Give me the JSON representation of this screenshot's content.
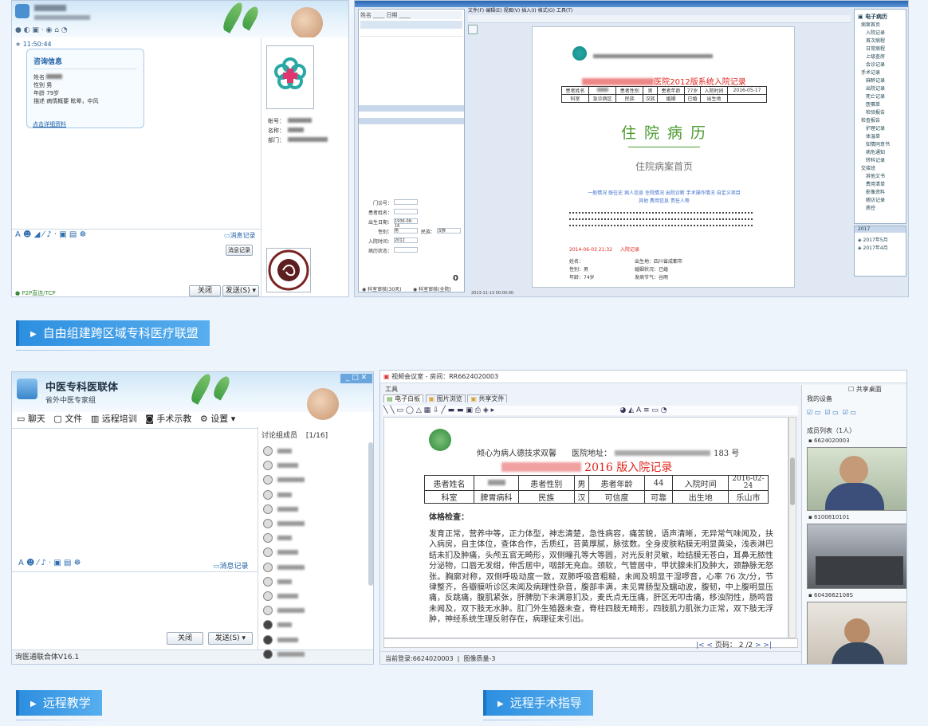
{
  "captions": {
    "alliance": "自由组建跨区域专科医疗联盟",
    "teaching": "远程教学",
    "surgery": "远程手术指导"
  },
  "chat1": {
    "time": "11:50:44",
    "card_title": "咨询信息",
    "fields": [
      {
        "label": "姓名",
        "value": ""
      },
      {
        "label": "性别",
        "value": "男"
      },
      {
        "label": "年龄",
        "value": "79岁"
      },
      {
        "label": "描述",
        "value": "病情概要 眩晕，中风"
      }
    ],
    "card_link": "点击详细资料",
    "profile_labels": [
      "帐号：",
      "名称：",
      "部门："
    ],
    "history_label": "消息记录",
    "history_button": "消息记录",
    "close_button": "关闭",
    "send_button": "发送(S)",
    "status": "P2P直连/TCP"
  },
  "emr1": {
    "menu": [
      "文件(F)",
      "编辑(E)",
      "视图(V)",
      "插入(I)",
      "格式(O)",
      "工具(T)"
    ],
    "record_title": "医院2012版系统入院记录",
    "table_row1": [
      "患者姓名",
      "",
      "患者性别",
      "男",
      "患者年龄",
      "77岁",
      "入院时间",
      "2016-05-17"
    ],
    "table_row2": [
      "科室",
      "急诊病区",
      "民族",
      "汉族",
      "婚姻",
      "已婚",
      "出生地",
      ""
    ],
    "big_title": "住 院 病 历",
    "sub_title": "住院病案首页",
    "link_line1": "一般情况 既往史 病人信息 住院情况 出院诊断 手术操作情况 自定义项目",
    "link_line2": "其他 费用信息 责任人等",
    "entry_date": "2014-06-03 21:32",
    "entry_label": "入院记录",
    "info_lines": [
      "姓名：",
      "性别：男",
      "年龄：74岁"
    ],
    "info_lines_right": [
      "出生地：四川省成都市",
      "婚姻状况：已婚",
      "发病节气：谷雨"
    ],
    "tree_title": "电子病历",
    "tree_items": [
      "病案首页",
      "入院记录",
      "首次病程",
      "日常病程",
      "上级查房",
      "会诊记录",
      "手术记录",
      "麻醉记录",
      "出院记录",
      "死亡记录",
      "医嘱单",
      "检验报告",
      "检查报告",
      "护理记录",
      "体温单",
      "知情同意书",
      "病危通知",
      "转科记录",
      "交接班",
      "其他文书",
      "费用清单",
      "影像资料",
      "随访记录",
      "质控"
    ],
    "right_bottom": [
      "2017",
      "2017年5月",
      "2017年4月"
    ],
    "form_labels": [
      "门诊号：",
      "身份证号：",
      "患者姓名：",
      "出生日期：",
      "性别：",
      "民族：",
      "患者类型：",
      "入院时间：",
      "入院病区：",
      "主管医生：",
      "出院时间：",
      "出院诊断：",
      "入院诊断：",
      "病历状态："
    ],
    "form_values": [
      "",
      "",
      "",
      "1936-08-16",
      "男",
      "汉族",
      "",
      "2012",
      "",
      "",
      "",
      "",
      "",
      ""
    ],
    "left_checkboxes": [
      "科室审核(30天)",
      "科室审核(全院)"
    ],
    "status_date": "2013-11-13 00:00:00",
    "badge": "0"
  },
  "chat2": {
    "app_title": "中医专科医联体",
    "subtitle": "省外中医专家组",
    "tabs": [
      "聊天",
      "文件",
      "远程培训",
      "手术示教",
      "设置"
    ],
    "group_header": "讨论组成员",
    "group_count": "[1/16]",
    "history_label": "消息记录",
    "close_button": "关闭",
    "send_button": "发送(S)",
    "status": "询医通联合体V16.1",
    "members": [
      "",
      "",
      "",
      "",
      "",
      "",
      "",
      "",
      "",
      "",
      "",
      "",
      "",
      "",
      ""
    ]
  },
  "video": {
    "window_title": "视频会议室 - 房间：RR6624020003",
    "menu_label": "工具",
    "tabs": [
      "电子白板",
      "图片浏览",
      "共享文件"
    ],
    "header_slogan": "倾心为病人德技求双馨",
    "header_address_label": "医院地址：",
    "header_address_num": "183 号",
    "record_title": "2016 版入院记录",
    "table_row1": [
      "患者姓名",
      "",
      "患者性别",
      "男",
      "患者年龄",
      "44",
      "入院时间",
      "2016-02-24"
    ],
    "table_row2": [
      "科室",
      "脾胃病科",
      "民族",
      "汉",
      "可信度",
      "可靠",
      "出生地",
      "乐山市"
    ],
    "section": "体格检查：",
    "body": "发育正常，营养中等，正力体型，神志清楚，急性病容，痛苦貌，语声清晰，无异常气味闻及，扶入病房，自主体位，查体合作，舌质红，苔黄厚腻，脉弦数。全身皮肤粘膜无明显黄染，浅表淋巴结未扪及肿痛，头颅五官无畸形，双侧瞳孔等大等圆，对光反射灵敏，睑结膜无苍白，耳鼻无脓性分泌物，口唇无发绀，伸舌居中，咽部无充血。颈软，气管居中，甲状腺未扪及肿大，颈静脉无怒张。胸廓对称，双侧呼吸动度一致，双肺呼吸音粗糙，未闻及明显干湿啰音，心率 76 次/分，节律整齐，各瓣膜听诊区未闻及病理性杂音，腹部丰满，未见胃肠型及蠕动波，腹韧，中上腹明显压痛，反跳痛，腹肌紧张，肝脾肋下未满意扪及，麦氏点无压痛，肝区无叩击痛，移浊阴性，肠鸣音未闻及，双下肢无水肿。肛门外生殖器未查，脊柱四肢无畸形，四肢肌力肌张力正常，双下肢无浮肿，神经系统生理反射存在，病理征未引出。",
    "page_label": "页码：",
    "page_current": "2",
    "page_total": "/2",
    "status_left": "当前登录:6624020003",
    "status_right": "图像质量-3",
    "device_title": "我的设备",
    "share_desktop": "共享桌面",
    "member_list": "成员列表（1人）",
    "cams": [
      "6624020003",
      "6100810101",
      "6043662108S"
    ]
  },
  "colors": {
    "banner": "#3d9be6",
    "record_red": "#e0241b",
    "title_green": "#4a9a2d"
  }
}
